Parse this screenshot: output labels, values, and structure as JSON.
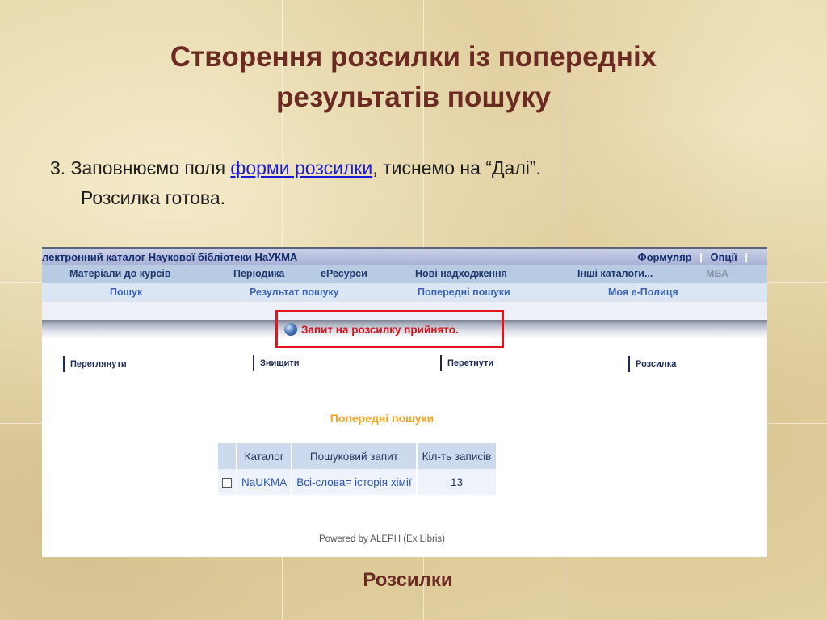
{
  "slide": {
    "title_line1": "Створення розсилки із попередніх",
    "title_line2": "результатів пошуку",
    "instruction_prefix": "3. Заповнюємо поля ",
    "instruction_link": "форми розсилки",
    "instruction_suffix": ", тиснемо на “Далі”.",
    "instruction_line2": "Розсилка готова.",
    "footer": "Розсилки"
  },
  "app": {
    "catalog_title": "лектронний каталог Наукової бібліотеки НаУКМА",
    "top_links": [
      "Формуляр",
      "Опції"
    ],
    "separator": "|",
    "nav_primary": [
      "Матеріали до курсів",
      "Періодика",
      "еРесурси",
      "Нові надходження",
      "Інші каталоги...",
      "МБА"
    ],
    "nav_secondary": [
      "Пошук",
      "Результат пошуку",
      "Попередні пошуки",
      "Моя е-Полиця"
    ],
    "accept_message": "Запит на розсилку прийнято.",
    "actions": [
      "Переглянути",
      "Знищити",
      "Перетнути",
      "Розсилка"
    ],
    "section_title": "Попередні пошуки",
    "table": {
      "headers": [
        "Каталог",
        "Пошуковий запит",
        "Кіл-ть записів"
      ],
      "rows": [
        {
          "catalog": "NaUKMA",
          "query": "Всі-слова= історія хімії",
          "count": "13"
        }
      ]
    },
    "powered_by": "Powered by ALEPH (Ex Libris)"
  },
  "colors": {
    "title": "#6b2b22",
    "link": "#1a1ad6",
    "accent_red": "#e4141c",
    "section_orange": "#f2a41c",
    "nav_dark": "#20386f"
  }
}
